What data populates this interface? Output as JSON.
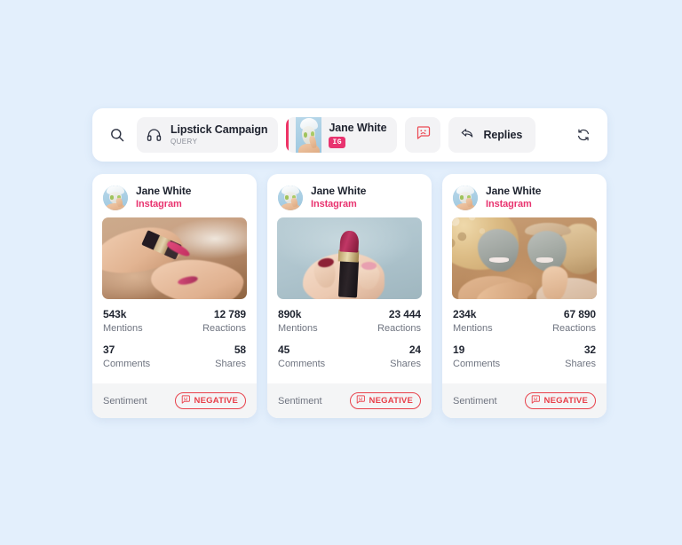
{
  "theme": {
    "page_background": "#e3effc",
    "card_background": "#ffffff",
    "chip_background": "#f3f3f5",
    "accent_pink": "#e8336f",
    "negative_red": "#e8404a",
    "text_primary": "#1f2430",
    "text_muted": "#6f7480",
    "footer_background": "#f4f5f6"
  },
  "toolbar": {
    "search_icon": "search-icon",
    "query_chip": {
      "icon": "headphones-icon",
      "title": "Lipstick Campaign",
      "subtitle": "QUERY"
    },
    "profile_chip": {
      "avatar": "jane-white-avatar",
      "name": "Jane White",
      "network_badge": "IG"
    },
    "sentiment_filter": {
      "icon": "sad-face-bubble-icon",
      "label": ""
    },
    "replies_chip": {
      "icon": "reply-arrow-icon",
      "label": "Replies"
    },
    "refresh_icon": "refresh-icon"
  },
  "cards": [
    {
      "avatar": "jane-white-avatar",
      "username": "Jane White",
      "network": "Instagram",
      "media": "hands-holding-lipstick-photo",
      "stats": [
        {
          "value": "543k",
          "label": "Mentions"
        },
        {
          "value": "12 789",
          "label": "Reactions"
        },
        {
          "value": "37",
          "label": "Comments"
        },
        {
          "value": "58",
          "label": "Shares"
        }
      ],
      "sentiment": {
        "label": "Sentiment",
        "badge_icon": "sad-face-bubble-icon",
        "badge_text": "NEGATIVE"
      }
    },
    {
      "avatar": "jane-white-avatar",
      "username": "Jane White",
      "network": "Instagram",
      "media": "hand-holding-lipstick-blue-background-photo",
      "stats": [
        {
          "value": "890k",
          "label": "Mentions"
        },
        {
          "value": "23 444",
          "label": "Reactions"
        },
        {
          "value": "45",
          "label": "Comments"
        },
        {
          "value": "24",
          "label": "Shares"
        }
      ],
      "sentiment": {
        "label": "Sentiment",
        "badge_icon": "sad-face-bubble-icon",
        "badge_text": "NEGATIVE"
      }
    },
    {
      "avatar": "jane-white-avatar",
      "username": "Jane White",
      "network": "Instagram",
      "media": "two-women-clay-face-mask-photo",
      "stats": [
        {
          "value": "234k",
          "label": "Mentions"
        },
        {
          "value": "67 890",
          "label": "Reactions"
        },
        {
          "value": "19",
          "label": "Comments"
        },
        {
          "value": "32",
          "label": "Shares"
        }
      ],
      "sentiment": {
        "label": "Sentiment",
        "badge_icon": "sad-face-bubble-icon",
        "badge_text": "NEGATIVE"
      }
    }
  ]
}
